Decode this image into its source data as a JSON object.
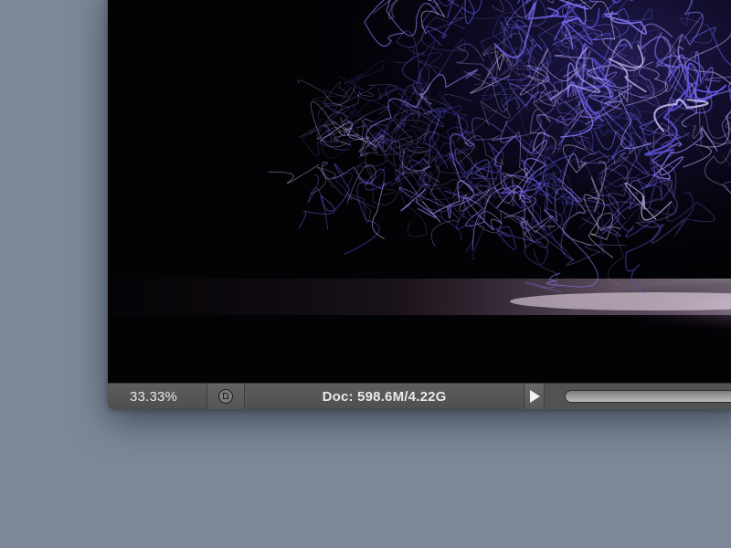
{
  "status_bar": {
    "zoom": "33.33%",
    "doc_info": "Doc: 598.6M/4.22G"
  },
  "icons": {
    "info": "document-info-icon",
    "arrow": "play-triangle-icon"
  },
  "colors": {
    "desktop": "#7c8898",
    "status_bar": "#555555",
    "canvas": "#030205",
    "light_trails": "#8a7cff"
  }
}
